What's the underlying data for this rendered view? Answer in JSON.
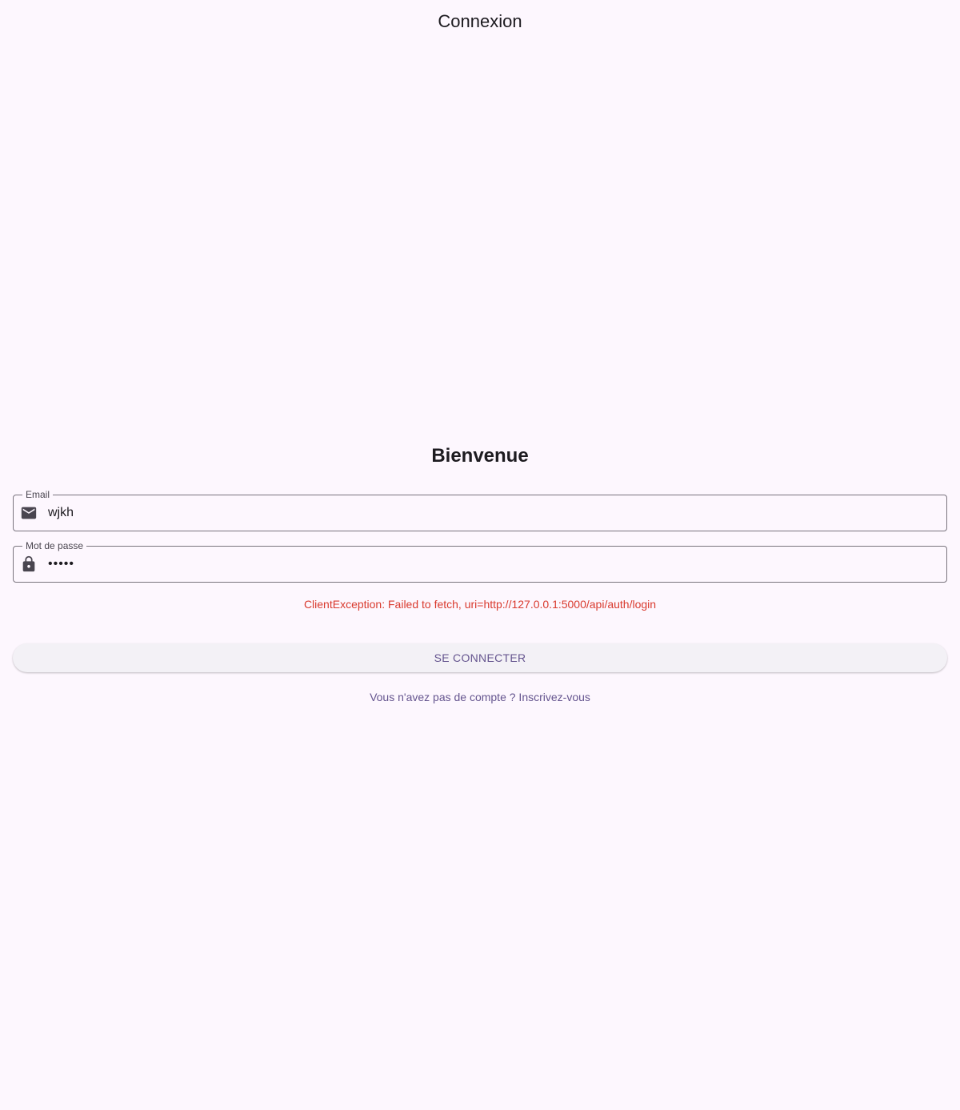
{
  "app_bar": {
    "title": "Connexion"
  },
  "form": {
    "welcome_title": "Bienvenue",
    "email": {
      "label": "Email",
      "value": "wjkh",
      "icon": "mail-icon"
    },
    "password": {
      "label": "Mot de passe",
      "value": "•••••",
      "icon": "lock-icon"
    },
    "error_message": "ClientException: Failed to fetch, uri=http://127.0.0.1:5000/api/auth/login",
    "login_button_label": "SE CONNECTER",
    "signup_link": "Vous n'avez pas de compte ? Inscrivez-vous"
  },
  "colors": {
    "background": "#fdf7fe",
    "primary": "#65558f",
    "error": "#d93a2e",
    "outline": "#79747e"
  }
}
